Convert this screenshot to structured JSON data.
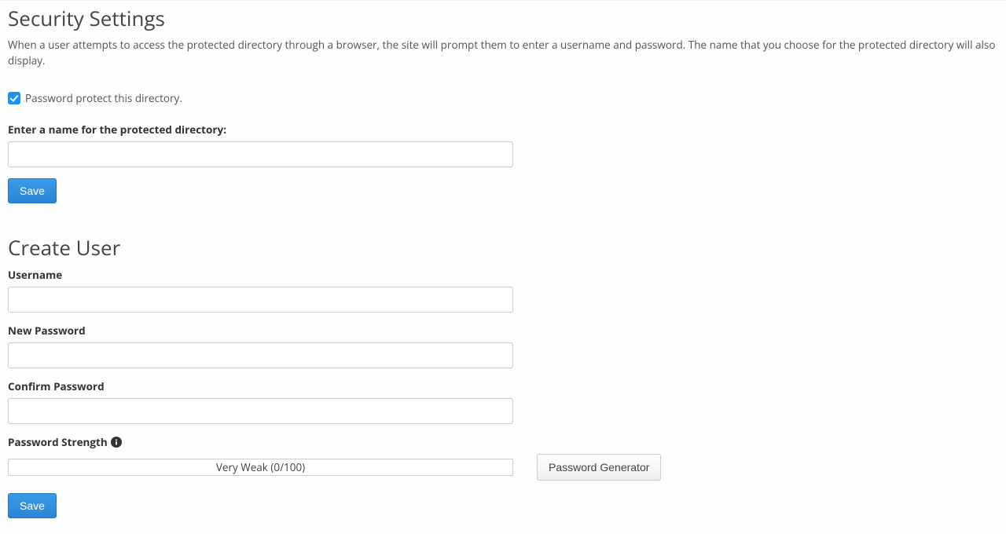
{
  "security": {
    "heading": "Security Settings",
    "description": "When a user attempts to access the protected directory through a browser, the site will prompt them to enter a username and password. The name that you choose for the protected directory will also display.",
    "checkbox_label": "Password protect this directory.",
    "checkbox_checked": true,
    "dirname_label": "Enter a name for the protected directory:",
    "dirname_value": "",
    "save_label": "Save"
  },
  "create_user": {
    "heading": "Create User",
    "username_label": "Username",
    "username_value": "",
    "newpass_label": "New Password",
    "newpass_value": "",
    "confirm_label": "Confirm Password",
    "confirm_value": "",
    "strength_label": "Password Strength",
    "strength_text": "Very Weak (0/100)",
    "generator_label": "Password Generator",
    "save_label": "Save"
  }
}
